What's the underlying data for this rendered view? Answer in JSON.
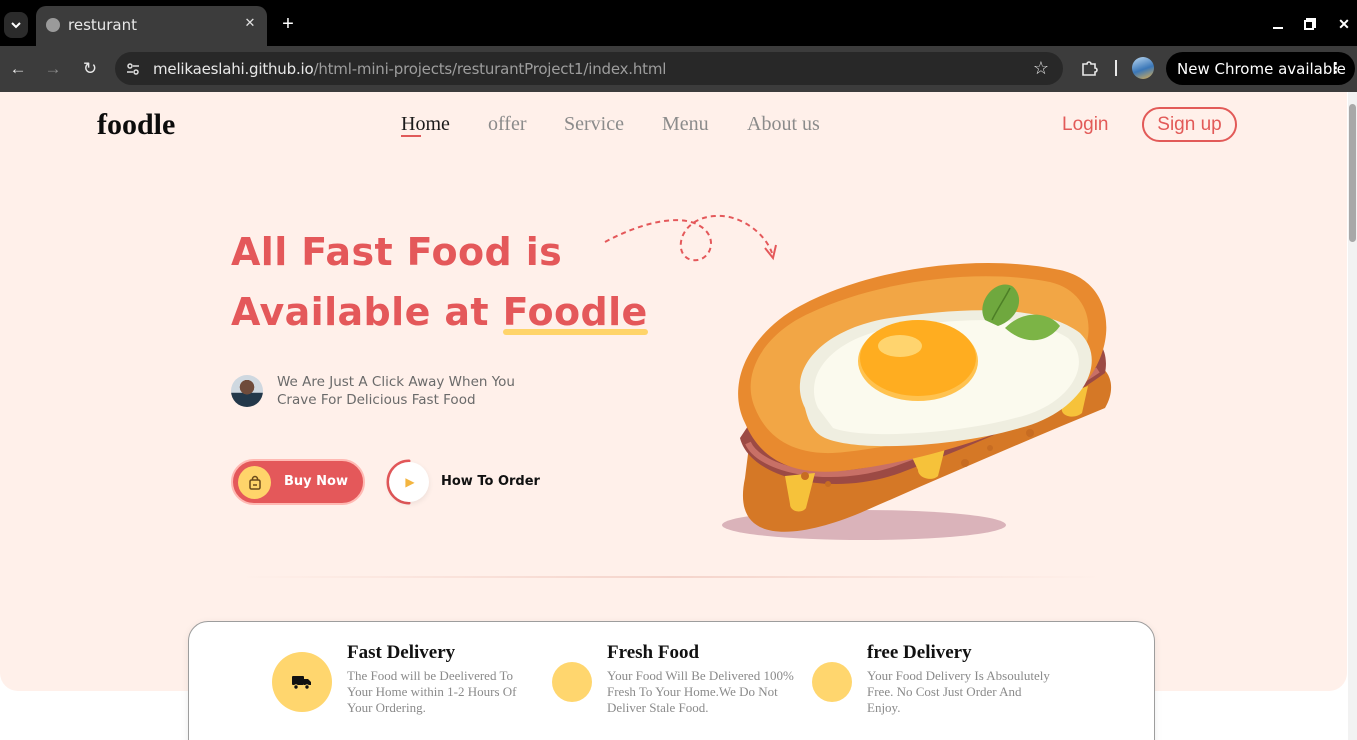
{
  "browser": {
    "tab_title": "resturant",
    "url_host": "melikaeslahi.github.io",
    "url_path": "/html-mini-projects/resturantProject1/index.html",
    "update_label": "New Chrome available"
  },
  "site": {
    "logo": "foodle",
    "nav": {
      "home": "Home",
      "offer": "offer",
      "service": "Service",
      "menu": "Menu",
      "about": "About us"
    },
    "login": "Login",
    "signup": "Sign up"
  },
  "hero": {
    "title_line1": "All Fast Food is",
    "title_line2_prefix": "Available at ",
    "title_highlight": "Foodle",
    "tagline_line1": "We Are Just A Click Away When You",
    "tagline_line2": "Crave For Delicious Fast Food",
    "buy_label": "Buy Now",
    "how_label": "How To Order"
  },
  "features": [
    {
      "title": "Fast Delivery",
      "desc_lines": [
        "The Food will be Deelivered To",
        "Your Home within 1-2 Hours Of",
        "Your Ordering."
      ],
      "icon": "truck-icon"
    },
    {
      "title": "Fresh Food",
      "desc_lines": [
        "Your Food Will Be Delivered 100%",
        "Fresh To Your Home.We Do Not",
        "Deliver Stale Food."
      ],
      "icon": "leaf-icon"
    },
    {
      "title": "free Delivery",
      "desc_lines": [
        "Your Food Delivery Is Absoulutely",
        "Free. No Cost Just Order And",
        "Enjoy."
      ],
      "icon": "gift-icon"
    }
  ],
  "colors": {
    "accent_red": "#e4585a",
    "accent_yellow": "#ffd46a",
    "hero_bg": "#fff0ea"
  }
}
